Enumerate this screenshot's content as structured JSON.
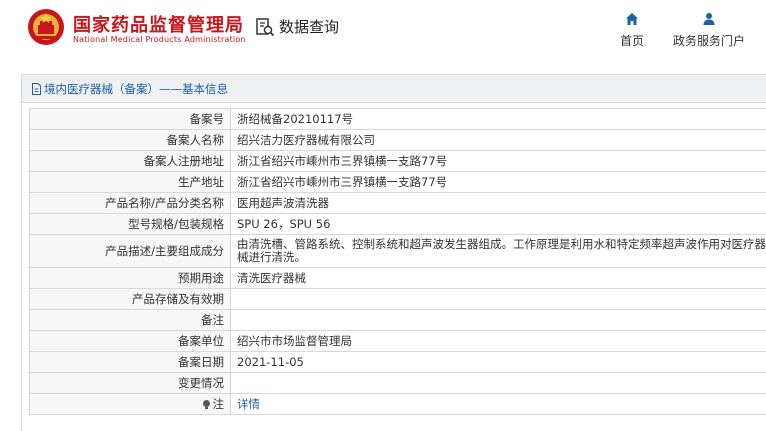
{
  "header": {
    "brand_cn": "国家药品监督管理局",
    "brand_en": "National Medical Products Administration",
    "data_query": "数据查询",
    "nav": [
      {
        "label": "首页",
        "icon": "home-icon"
      },
      {
        "label": "政务服务门户",
        "icon": "user-icon"
      }
    ]
  },
  "colors": {
    "brand_red": "#c8161d",
    "link_blue": "#1d5fa8",
    "label_bg": "#f7f7f7",
    "head_bg": "#eef0f1"
  },
  "panel": {
    "title": "境内医疗器械（备案）——基本信息"
  },
  "rows": [
    {
      "label": "备案号",
      "value": "浙绍械备20210117号"
    },
    {
      "label": "备案人名称",
      "value": "绍兴洁力医疗器械有限公司"
    },
    {
      "label": "备案人注册地址",
      "value": "浙江省绍兴市嵊州市三界镇横一支路77号"
    },
    {
      "label": "生产地址",
      "value": "浙江省绍兴市嵊州市三界镇横一支路77号"
    },
    {
      "label": "产品名称/产品分类名称",
      "value": "医用超声波清洗器"
    },
    {
      "label": "型号规格/包装规格",
      "value": "SPU 26，SPU 56"
    },
    {
      "label": "产品描述/主要组成成分",
      "value": "由清洗槽、管路系统、控制系统和超声波发生器组成。工作原理是利用水和特定频率超声波作用对医疗器械进行清洗。"
    },
    {
      "label": "预期用途",
      "value": "清洗医疗器械"
    },
    {
      "label": "产品存储及有效期",
      "value": ""
    },
    {
      "label": "备注",
      "value": ""
    },
    {
      "label": "备案单位",
      "value": "绍兴市市场监督管理局"
    },
    {
      "label": "备案日期",
      "value": "2021-11-05"
    },
    {
      "label": "变更情况",
      "value": ""
    },
    {
      "label": "注",
      "value": "详情",
      "icon": "info-bulb-icon"
    }
  ]
}
